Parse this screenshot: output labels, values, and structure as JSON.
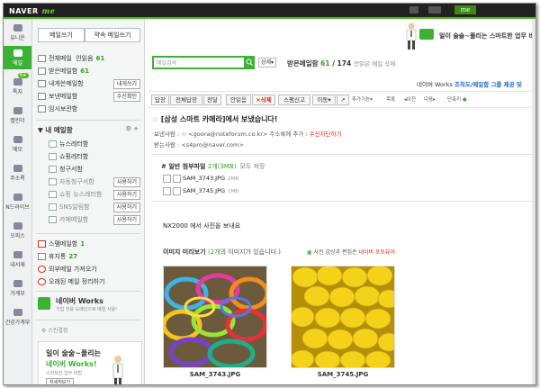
{
  "topbar": {
    "logo_text": "NAVER",
    "logo_me": "me",
    "me_tab": "me"
  },
  "rail": [
    {
      "label": "유니온",
      "badge": ""
    },
    {
      "label": "메일",
      "badge": ""
    },
    {
      "label": "톡지",
      "badge": "6★"
    },
    {
      "label": "캘린더",
      "badge": ""
    },
    {
      "label": "메모",
      "badge": ""
    },
    {
      "label": "주소록",
      "badge": ""
    },
    {
      "label": "N드라이브",
      "badge": ""
    },
    {
      "label": "오피스",
      "badge": ""
    },
    {
      "label": "내서재",
      "badge": ""
    },
    {
      "label": "가계부",
      "badge": ""
    },
    {
      "label": "건강가계부",
      "badge": ""
    }
  ],
  "sidebar": {
    "compose": "메일쓰기",
    "reserve": "약속 메일쓰기",
    "all_mail": "전체메일",
    "unread": "안읽음",
    "unread_count": "61",
    "inbox": "받은메일함",
    "inbox_count": "61",
    "to_me": "내게쓴메일함",
    "to_me_tag": "내게쓰기",
    "sent": "보낸메일함",
    "sent_tag": "수신확인",
    "temp": "임시보관함",
    "my_folders": "내 메일함",
    "folders": [
      {
        "label": "뉴스레터함",
        "tag": ""
      },
      {
        "label": "쇼핑레터함",
        "tag": ""
      },
      {
        "label": "청구서함",
        "tag": ""
      },
      {
        "label": "자동청구서함",
        "tag": "사용하기"
      },
      {
        "label": "쇼핑 뉴스레터함",
        "tag": "사용하기"
      },
      {
        "label": "SNS알림함",
        "tag": "사용하기"
      },
      {
        "label": "카페메일함",
        "tag": "사용하기"
      }
    ],
    "spam": "스팸메일함",
    "spam_count": "1",
    "trash": "휴지통",
    "trash_count": "27",
    "external": "외부메일 가져오기",
    "cleanup": "오래된 메일 정리하기",
    "works_title": "네이버 Works",
    "works_sub": "기업 전용 도메인으로 메일 사용!",
    "payment": "스킨결정",
    "ad_line1": "일이 술술~풀리는",
    "ad_line2": "네이버 Works!",
    "ad_line3": "스마트한 업무 비법",
    "ad_btn": "자세히보기"
  },
  "main": {
    "banner_text": "일이 술술~풀리는 스마트한 업무 비법",
    "search_placeholder": "메일검색",
    "detail_btn": "상세",
    "inbox_title": "받은메일함",
    "inbox_unread": "61",
    "inbox_total": "/ 174",
    "inbox_sub": "안읽은 메일 삭제",
    "ticker_prefix": "네이버 Works",
    "ticker_text": "조직도/메일함 그룹 제공 및",
    "toolbar": [
      "답장",
      "전체답장",
      "전달",
      "안읽음",
      "×삭제",
      "스팸신고",
      "이동"
    ],
    "toolbar_more": "추가기능",
    "toolbar_list": "목록",
    "toolbar_prev": "◂이전",
    "toolbar_next": "다음▸",
    "toolbar_shortcut": "단축키",
    "subject": "[삼성 스마트 카메라]에서 보냈습니다!",
    "from_label": "보낸사람 :",
    "from_value": "<goora@noteforum.co.kr>",
    "from_add": "주소록에 추가 :",
    "from_block": "수신차단하기",
    "to_label": "받는사람 :",
    "to_value": "<s4pro@naver.com>",
    "attach_label": "일반 첨부파일",
    "attach_size": "2개(3MB)",
    "attach_all": "모두 저장",
    "files": [
      {
        "name": "SAM_3743.JPG",
        "size": "2MB"
      },
      {
        "name": "SAM_3745.JPG",
        "size": "1MB"
      }
    ],
    "body": "NX2000 에서 사진을 보내요",
    "preview_title": "이미지 미리보기",
    "preview_count": "(2개",
    "preview_rest": "의 이미지가 있습니다.)",
    "preview_note": "사진 감상과 편집은",
    "preview_note_link": "네이버 포토뷰어",
    "captions": [
      "SAM_3743.JPG",
      "SAM_3745.JPG"
    ]
  }
}
